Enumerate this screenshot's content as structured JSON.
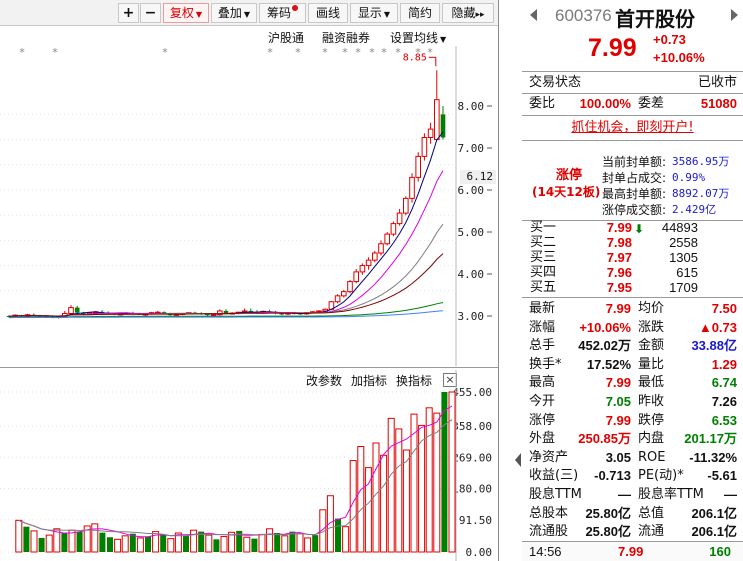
{
  "toolbar": {
    "plus": "+",
    "minus": "−",
    "fuquan": "复权",
    "diejia": "叠加",
    "chouma": "筹码",
    "huaxian": "画线",
    "xianshi": "显示",
    "jianyue": "简约",
    "yincang": "隐藏",
    "more": "▸▸"
  },
  "subbar": {
    "hgt": "沪股通",
    "rzrq": "融资融券",
    "ma_settings": "设置均线"
  },
  "indicator_bar": {
    "params": "改参数",
    "add": "加指标",
    "switch": "换指标",
    "close": "×"
  },
  "price_chart": {
    "y_ticks": [
      "8.00",
      "7.00",
      "6.00",
      "5.00",
      "4.00",
      "3.00"
    ],
    "high_label": "8.85",
    "current_tag": "6.12",
    "candles": [
      [
        3.0,
        3.02,
        2.96,
        2.99
      ],
      [
        2.99,
        3.04,
        2.97,
        3.02
      ],
      [
        3.02,
        3.03,
        2.98,
        3.0
      ],
      [
        3.0,
        3.05,
        2.99,
        3.03
      ],
      [
        3.03,
        3.06,
        3.0,
        3.01
      ],
      [
        3.01,
        3.03,
        2.97,
        2.98
      ],
      [
        2.98,
        3.01,
        2.95,
        3.0
      ],
      [
        3.0,
        3.02,
        2.96,
        2.97
      ],
      [
        2.97,
        3.0,
        2.94,
        2.99
      ],
      [
        2.99,
        3.12,
        2.98,
        3.06
      ],
      [
        3.06,
        3.26,
        3.04,
        3.2
      ],
      [
        3.2,
        3.24,
        3.05,
        3.08
      ],
      [
        3.08,
        3.1,
        3.01,
        3.04
      ],
      [
        3.04,
        3.09,
        3.02,
        3.07
      ],
      [
        3.07,
        3.12,
        3.05,
        3.1
      ],
      [
        3.1,
        3.14,
        3.06,
        3.08
      ],
      [
        3.08,
        3.11,
        3.04,
        3.06
      ],
      [
        3.06,
        3.08,
        3.02,
        3.04
      ],
      [
        3.04,
        3.07,
        3.01,
        3.05
      ],
      [
        3.05,
        3.09,
        3.03,
        3.07
      ],
      [
        3.07,
        3.1,
        3.04,
        3.06
      ],
      [
        3.06,
        3.08,
        3.02,
        3.03
      ],
      [
        3.03,
        3.06,
        3.0,
        3.05
      ],
      [
        3.05,
        3.1,
        3.03,
        3.08
      ],
      [
        3.08,
        3.12,
        3.05,
        3.09
      ],
      [
        3.09,
        3.11,
        3.04,
        3.06
      ],
      [
        3.06,
        3.08,
        3.01,
        3.02
      ],
      [
        3.02,
        3.05,
        2.99,
        3.04
      ],
      [
        3.04,
        3.07,
        3.02,
        3.06
      ],
      [
        3.06,
        3.09,
        3.04,
        3.08
      ],
      [
        3.08,
        3.1,
        3.05,
        3.07
      ],
      [
        3.07,
        3.09,
        3.03,
        3.05
      ],
      [
        3.05,
        3.07,
        3.0,
        3.02
      ],
      [
        3.02,
        3.05,
        2.99,
        3.03
      ],
      [
        3.03,
        3.16,
        3.01,
        3.12
      ],
      [
        3.12,
        3.16,
        3.04,
        3.06
      ],
      [
        3.06,
        3.09,
        3.03,
        3.07
      ],
      [
        3.07,
        3.1,
        3.04,
        3.09
      ],
      [
        3.09,
        3.18,
        3.07,
        3.12
      ],
      [
        3.12,
        3.18,
        3.08,
        3.1
      ],
      [
        3.1,
        3.14,
        3.06,
        3.08
      ],
      [
        3.08,
        3.13,
        3.05,
        3.11
      ],
      [
        3.11,
        3.15,
        3.07,
        3.09
      ],
      [
        3.09,
        3.12,
        3.04,
        3.06
      ],
      [
        3.06,
        3.09,
        3.02,
        3.05
      ],
      [
        3.05,
        3.08,
        3.02,
        3.07
      ],
      [
        3.07,
        3.1,
        3.04,
        3.06
      ],
      [
        3.06,
        3.08,
        3.03,
        3.05
      ],
      [
        3.05,
        3.09,
        3.03,
        3.08
      ],
      [
        3.08,
        3.12,
        3.06,
        3.1
      ],
      [
        3.1,
        3.14,
        3.08,
        3.12
      ],
      [
        3.12,
        3.18,
        3.1,
        3.16
      ],
      [
        3.16,
        3.36,
        3.14,
        3.34
      ],
      [
        3.34,
        3.52,
        3.3,
        3.48
      ],
      [
        3.48,
        3.62,
        3.44,
        3.58
      ],
      [
        3.58,
        3.86,
        3.54,
        3.82
      ],
      [
        3.82,
        4.12,
        3.78,
        4.05
      ],
      [
        4.05,
        4.25,
        3.98,
        4.2
      ],
      [
        4.2,
        4.4,
        4.1,
        4.33
      ],
      [
        4.33,
        4.55,
        4.28,
        4.5
      ],
      [
        4.5,
        4.8,
        4.44,
        4.72
      ],
      [
        4.72,
        5.0,
        4.68,
        4.95
      ],
      [
        4.95,
        5.25,
        4.9,
        5.2
      ],
      [
        5.2,
        5.55,
        5.15,
        5.45
      ],
      [
        5.45,
        5.85,
        5.4,
        5.8
      ],
      [
        5.8,
        6.4,
        5.7,
        6.3
      ],
      [
        6.3,
        6.9,
        6.2,
        6.8
      ],
      [
        6.8,
        7.35,
        6.7,
        7.25
      ],
      [
        7.25,
        7.6,
        7.1,
        7.45
      ],
      [
        7.2,
        8.85,
        7.18,
        8.15
      ],
      [
        7.8,
        8.0,
        7.2,
        7.25
      ]
    ]
  },
  "volume_chart": {
    "y_ticks": [
      "455.00",
      "358.00",
      "269.00",
      "180.00",
      "91.50",
      "0.00"
    ],
    "bars": [
      [
        90,
        1
      ],
      [
        72,
        0
      ],
      [
        60,
        1
      ],
      [
        40,
        0
      ],
      [
        48,
        1
      ],
      [
        66,
        1
      ],
      [
        55,
        0
      ],
      [
        62,
        1
      ],
      [
        58,
        0
      ],
      [
        74,
        1
      ],
      [
        80,
        1
      ],
      [
        55,
        0
      ],
      [
        42,
        0
      ],
      [
        36,
        1
      ],
      [
        46,
        1
      ],
      [
        52,
        0
      ],
      [
        40,
        1
      ],
      [
        44,
        0
      ],
      [
        58,
        1
      ],
      [
        50,
        0
      ],
      [
        38,
        1
      ],
      [
        54,
        1
      ],
      [
        46,
        0
      ],
      [
        62,
        1
      ],
      [
        58,
        0
      ],
      [
        48,
        1
      ],
      [
        36,
        0
      ],
      [
        44,
        1
      ],
      [
        56,
        1
      ],
      [
        60,
        0
      ],
      [
        42,
        1
      ],
      [
        38,
        0
      ],
      [
        50,
        1
      ],
      [
        66,
        1
      ],
      [
        54,
        0
      ],
      [
        46,
        1
      ],
      [
        58,
        0
      ],
      [
        52,
        1
      ],
      [
        40,
        1
      ],
      [
        48,
        0
      ],
      [
        120,
        1
      ],
      [
        160,
        1
      ],
      [
        95,
        0
      ],
      [
        72,
        1
      ],
      [
        260,
        1
      ],
      [
        300,
        1
      ],
      [
        240,
        1
      ],
      [
        310,
        1
      ],
      [
        275,
        1
      ],
      [
        380,
        1
      ],
      [
        350,
        1
      ],
      [
        290,
        1
      ],
      [
        392,
        1
      ],
      [
        360,
        1
      ],
      [
        410,
        1
      ],
      [
        395,
        1
      ],
      [
        455,
        0
      ],
      [
        455,
        1
      ]
    ]
  },
  "quote": {
    "code": "600376",
    "name": "首开股份",
    "price": "7.99",
    "change": "+0.73",
    "change_pct": "+10.06%",
    "status_label": "交易状态",
    "status_value": "已收市",
    "weibi_label": "委比",
    "weibi_value": "100.00%",
    "weicha_label": "委差",
    "weicha_value": "51080",
    "promo": "抓住机会，即刻开户!",
    "limit_up_label": "涨停",
    "limit_up_streak": "(14天12板)",
    "limit_rows": [
      {
        "k": "当前封单额:",
        "v": "3586.95万"
      },
      {
        "k": "封单占成交:",
        "v": "0.99%"
      },
      {
        "k": "最高封单额:",
        "v": "8892.07万"
      },
      {
        "k": "涨停成交额:",
        "v": "2.429亿"
      }
    ],
    "orderbook": [
      {
        "level": "买一",
        "price": "7.99",
        "qty": "44893"
      },
      {
        "level": "买二",
        "price": "7.98",
        "qty": "2558"
      },
      {
        "level": "买三",
        "price": "7.97",
        "qty": "1305"
      },
      {
        "level": "买四",
        "price": "7.96",
        "qty": "615"
      },
      {
        "level": "买五",
        "price": "7.95",
        "qty": "1709"
      }
    ],
    "stats": [
      {
        "k1": "最新",
        "v1": "7.99",
        "c1": "red",
        "k2": "均价",
        "v2": "7.50",
        "c2": "red"
      },
      {
        "k1": "涨幅",
        "v1": "+10.06%",
        "c1": "red",
        "k2": "涨跌",
        "v2": "▲0.73",
        "c2": "red"
      },
      {
        "k1": "总手",
        "v1": "452.02万",
        "c1": "black",
        "k2": "金额",
        "v2": "33.88亿",
        "c2": "blue"
      },
      {
        "k1": "换手*",
        "v1": "17.52%",
        "c1": "black",
        "k2": "量比",
        "v2": "1.29",
        "c2": "red"
      },
      {
        "k1": "最高",
        "v1": "7.99",
        "c1": "red",
        "k2": "最低",
        "v2": "6.74",
        "c2": "green"
      },
      {
        "k1": "今开",
        "v1": "7.05",
        "c1": "green",
        "k2": "昨收",
        "v2": "7.26",
        "c2": "black"
      },
      {
        "k1": "涨停",
        "v1": "7.99",
        "c1": "red",
        "k2": "跌停",
        "v2": "6.53",
        "c2": "green"
      },
      {
        "k1": "外盘",
        "v1": "250.85万",
        "c1": "red",
        "k2": "内盘",
        "v2": "201.17万",
        "c2": "green"
      },
      {
        "k1": "净资产",
        "v1": "3.05",
        "c1": "black",
        "k2": "ROE",
        "v2": "-11.32%",
        "c2": "black"
      },
      {
        "k1": "收益(三)",
        "v1": "-0.713",
        "c1": "black",
        "k2": "PE(动)*",
        "v2": "-5.61",
        "c2": "black"
      },
      {
        "k1": "股息TTM",
        "v1": "—",
        "c1": "black",
        "k2": "股息率TTM",
        "v2": "—",
        "c2": "black"
      },
      {
        "k1": "总股本",
        "v1": "25.80亿",
        "c1": "black",
        "k2": "总值",
        "v2": "206.1亿",
        "c2": "black"
      },
      {
        "k1": "流通股",
        "v1": "25.80亿",
        "c1": "black",
        "k2": "流通",
        "v2": "206.1亿",
        "c2": "black"
      }
    ],
    "last_tick": {
      "time": "14:56",
      "price": "7.99",
      "vol": "160"
    }
  },
  "colors": {
    "up": "#e00000",
    "down": "#008000",
    "ma5": "#000080",
    "ma10": "#e000e0",
    "ma20": "#808080",
    "ma30": "#800000",
    "ma60": "#008000",
    "ma120": "#4080ff"
  }
}
